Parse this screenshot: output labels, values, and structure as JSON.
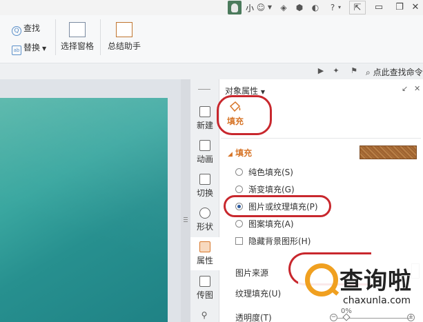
{
  "titlebar": {
    "user_name": "小",
    "icons": [
      "user-avatar",
      "dropdown-icon",
      "skin-icon",
      "cube-icon",
      "document-icon",
      "help-icon"
    ],
    "window_buttons": [
      "restore-icon",
      "minimize-icon",
      "maximize-icon",
      "close-icon"
    ]
  },
  "ribbon": {
    "find_label": "查找",
    "replace_label": "替换",
    "selection_pane_label": "选择窗格",
    "summary_helper_label": "总结助手"
  },
  "toolrow": {
    "search_command_label": "点此查找命令"
  },
  "sidebar": {
    "items": [
      {
        "label": "新建"
      },
      {
        "label": "动画"
      },
      {
        "label": "切换"
      },
      {
        "label": "形状"
      },
      {
        "label": "属性"
      },
      {
        "label": "传图"
      }
    ]
  },
  "panel": {
    "title": "对象属性",
    "tab_fill_label": "填充",
    "section_fill_label": "填充",
    "options": {
      "solid": "纯色填充(S)",
      "gradient": "渐变填充(G)",
      "picture_texture": "图片或纹理填充(P)",
      "pattern": "图案填充(A)"
    },
    "hide_background": "隐藏背景图形(H)",
    "picture_source_label": "图片来源",
    "texture_fill_label": "纹理填充(U)",
    "transparency_label": "透明度(T)",
    "transparency_value": "0%"
  },
  "watermark": {
    "brand": "查询啦",
    "url": "chaxunla.com"
  },
  "colors": {
    "accent_orange": "#d7762a",
    "annotation_red": "#c8272d",
    "slide_teal": "#2e9a96"
  }
}
